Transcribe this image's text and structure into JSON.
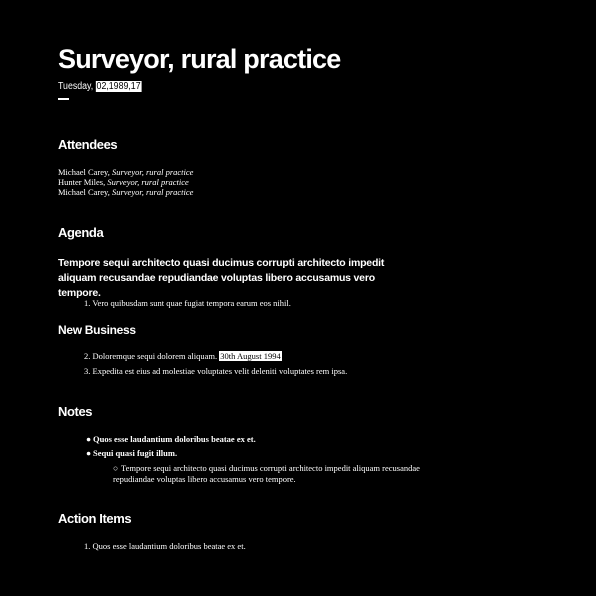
{
  "title": "Surveyor, rural practice",
  "dateline": {
    "prefix": "Tuesday,",
    "highlight": "02,1989,17"
  },
  "attendees": {
    "heading": "Attendees",
    "people": [
      {
        "name": "Michael Carey,",
        "role": "Surveyor, rural practice"
      },
      {
        "name": "Hunter Miles,",
        "role": "Surveyor, rural practice"
      },
      {
        "name": "Michael Carey,",
        "role": "Surveyor, rural practice"
      }
    ]
  },
  "agenda": {
    "heading": "Agenda",
    "lead": "Tempore sequi architecto quasi ducimus corrupti architecto impedit aliquam recusandae repudiandae voluptas libero accusamus vero tempore.",
    "items": [
      {
        "num": "1.",
        "text": "Vero quibusdam sunt quae fugiat tempora earum eos nihil."
      }
    ]
  },
  "new_business": {
    "heading": "New Business",
    "items": [
      {
        "num": "2.",
        "text": "Doloremque sequi dolorem aliquam.",
        "highlight": "30th August 1994"
      },
      {
        "num": "3.",
        "text": "Expedita est eius ad molestiae voluptates velit deleniti voluptates rem ipsa."
      }
    ]
  },
  "notes": {
    "heading": "Notes",
    "items": [
      {
        "bullet": "●",
        "text": "Quos esse laudantium doloribus beatae ex et."
      },
      {
        "bullet": "●",
        "text": "Sequi quasi fugit illum."
      }
    ],
    "sub_items": [
      {
        "bullet": "○",
        "line1": "Tempore sequi architecto quasi ducimus corrupti architecto impedit aliquam recusandae",
        "line2": "repudiandae voluptas libero accusamus vero tempore."
      }
    ]
  },
  "action_items": {
    "heading": "Action Items",
    "items": [
      {
        "num": "1.",
        "text": "Quos esse laudantium doloribus beatae ex et."
      }
    ]
  }
}
